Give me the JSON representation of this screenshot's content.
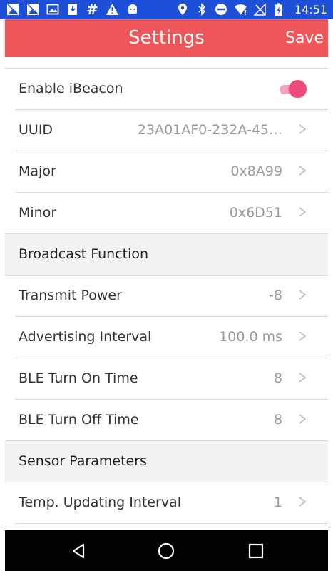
{
  "status_bar": {
    "time": "14:51",
    "left_icons": [
      "photo-icon",
      "photo-icon",
      "image-icon",
      "download-icon",
      "hash-icon",
      "warning-icon",
      "android-icon"
    ],
    "right_icons": [
      "location-icon",
      "bluetooth-icon",
      "do-not-disturb-icon",
      "wifi-icon",
      "no-sim-icon",
      "battery-charging-icon"
    ],
    "color": "#1d4fd8"
  },
  "app_bar": {
    "title": "Settings",
    "save_label": "Save",
    "color": "#ef5659"
  },
  "settings": {
    "enable_ibeacon": {
      "label": "Enable iBeacon",
      "on": true
    },
    "uuid": {
      "label": "UUID",
      "value": "23A01AF0-232A-45…"
    },
    "major": {
      "label": "Major",
      "value": "0x8A99"
    },
    "minor": {
      "label": "Minor",
      "value": "0x6D51"
    },
    "broadcast_section": "Broadcast Function",
    "transmit_power": {
      "label": "Transmit Power",
      "value": "-8"
    },
    "advertising_interval": {
      "label": "Advertising Interval",
      "value": "100.0 ms"
    },
    "ble_on_time": {
      "label": "BLE Turn On Time",
      "value": "8"
    },
    "ble_off_time": {
      "label": "BLE Turn Off Time",
      "value": "8"
    },
    "sensor_section": "Sensor Parameters",
    "temp_interval": {
      "label": "Temp. Updating Interval",
      "value": "1"
    }
  },
  "nav_bar": {
    "back": "back-icon",
    "home": "home-icon",
    "recents": "recents-icon"
  },
  "accent": "#ee4a7c"
}
